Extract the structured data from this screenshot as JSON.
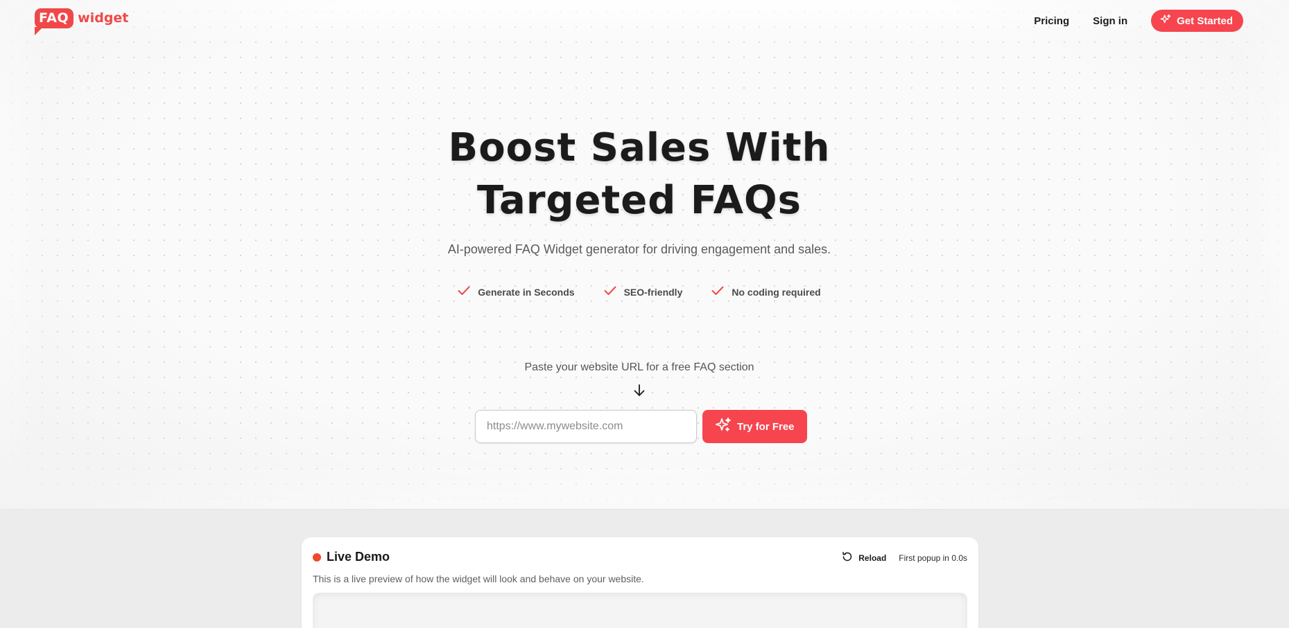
{
  "logo": {
    "badge": "FAQ",
    "word": "widget"
  },
  "nav": {
    "pricing": "Pricing",
    "signin": "Sign in",
    "get_started": "Get Started"
  },
  "hero": {
    "headline_line1": "Boost Sales With",
    "headline_line2": "Targeted FAQs",
    "subhead": "AI-powered FAQ Widget generator for driving engagement and sales.",
    "features": [
      "Generate in Seconds",
      "SEO-friendly",
      "No coding required"
    ],
    "paste_label": "Paste your website URL for a free FAQ section",
    "url_placeholder": "https://www.mywebsite.com",
    "try_button": "Try for Free"
  },
  "demo": {
    "title": "Live Demo",
    "reload": "Reload",
    "timer": "First popup in 0.0s",
    "description": "This is a live preview of how the widget will look and behave on your website."
  },
  "colors": {
    "accent": "#f6454f",
    "brand": "#f04848",
    "live_dot": "#f0482e"
  },
  "icons": {
    "logo": "speech-bubble-icon",
    "get_started": "sparkle-icon",
    "feature": "check-icon",
    "arrow": "arrow-down-icon",
    "try": "sparkle-icon",
    "reload": "reload-icon"
  }
}
